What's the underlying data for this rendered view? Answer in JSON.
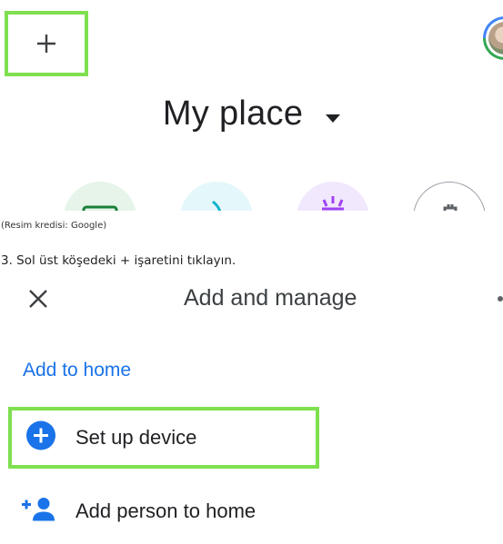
{
  "top_screen": {
    "title": "My place",
    "shortcuts": [
      {
        "icon": "wifi-icon",
        "color": "#e6f4ea"
      },
      {
        "icon": "lights-icon",
        "color": "#e4f7fb"
      },
      {
        "icon": "routines-icon",
        "color": "#f1e8fd"
      },
      {
        "icon": "settings-icon",
        "color": "#ffffff"
      }
    ]
  },
  "caption": {
    "credit": "(Resim kredisi: Google)",
    "step": "3. Sol üst köşedeki + işaretini tıklayın."
  },
  "add_manage": {
    "title": "Add and manage",
    "section_label": "Add to home",
    "items": [
      {
        "label": "Set up device",
        "icon": "add-circle-icon"
      },
      {
        "label": "Add person to home",
        "icon": "person-add-icon"
      }
    ]
  },
  "colors": {
    "highlight": "#7ee04f",
    "accent_blue": "#1a73e8",
    "text": "#202124"
  }
}
